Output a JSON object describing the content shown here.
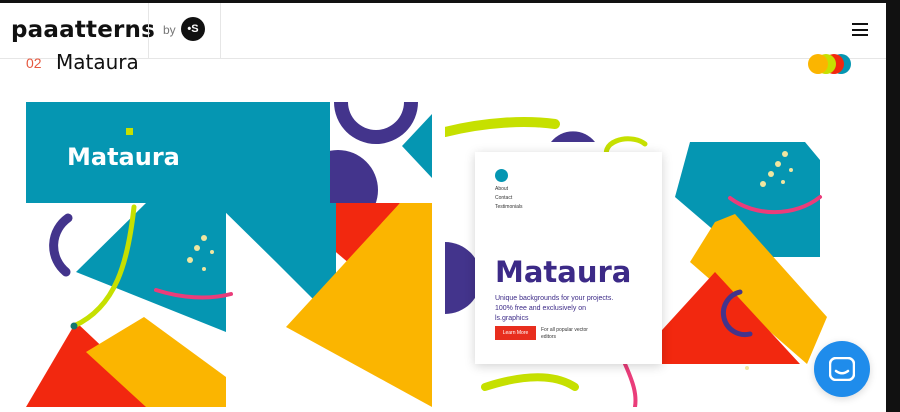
{
  "header": {
    "logo": "paaatterns",
    "by_label": "by",
    "brand_mark": "•S",
    "menu_icon": "hamburger-menu-icon"
  },
  "section": {
    "number": "02",
    "title": "Mataura"
  },
  "preview_left": {
    "title": "Mataura"
  },
  "preview_right": {
    "nav": [
      "About",
      "Contact",
      "Testimonials"
    ],
    "title": "Mataura",
    "subtitle": "Unique backgrounds for your projects. 100% free and exclusively on ls.graphics",
    "button_label": "Learn More",
    "note": "For all popular vector editors"
  },
  "palette": {
    "teal": "#0596b2",
    "purple": "#43348c",
    "red": "#f2280f",
    "yellow": "#fbb500",
    "lime": "#c6e000",
    "pink": "#ea3d7a",
    "chat_blue": "#1f8ceb"
  },
  "chat_widget": {
    "icon": "chat-icon"
  }
}
